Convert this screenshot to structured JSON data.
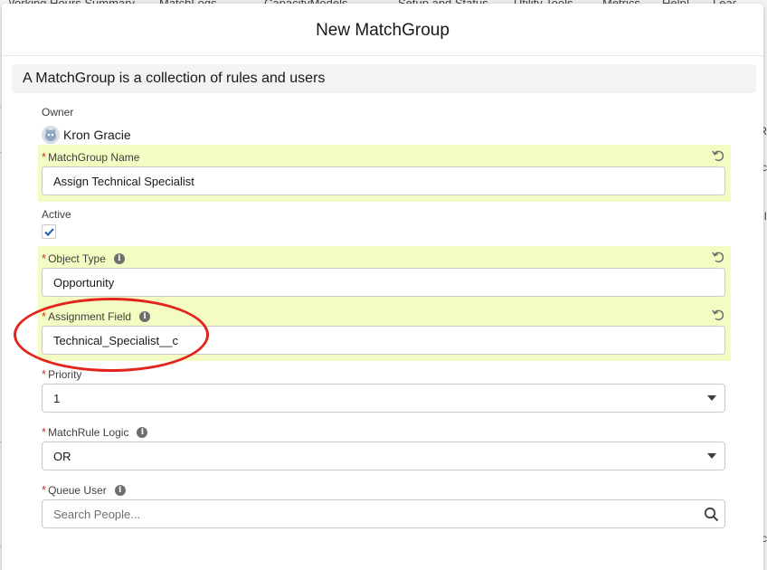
{
  "background": {
    "nav_items": [
      "Working Hours Summary",
      "MatchLogs",
      "CapacityModels",
      "Setup and Status",
      "Utility Tools",
      "Metrics",
      "Help!",
      "Leads"
    ],
    "right_cells": [
      "R",
      "c",
      "I",
      "c"
    ]
  },
  "modal": {
    "title": "New MatchGroup",
    "section_heading": "A MatchGroup is a collection of rules and users"
  },
  "fields": {
    "owner": {
      "label": "Owner",
      "value": "Kron Gracie"
    },
    "name": {
      "required_mark": "*",
      "label": "MatchGroup Name",
      "value": "Assign Technical Specialist"
    },
    "active": {
      "label": "Active",
      "checked": true
    },
    "object_type": {
      "required_mark": "*",
      "label": "Object Type",
      "value": "Opportunity"
    },
    "assignment_field": {
      "required_mark": "*",
      "label": "Assignment Field",
      "value": "Technical_Specialist__c"
    },
    "priority": {
      "required_mark": "*",
      "label": "Priority",
      "value": "1"
    },
    "logic": {
      "required_mark": "*",
      "label": "MatchRule Logic",
      "value": "OR"
    },
    "queue_user": {
      "required_mark": "*",
      "label": "Queue User",
      "placeholder": "Search People..."
    }
  },
  "icons": {
    "info": "info-icon",
    "undo": "undo-icon",
    "search": "search-icon",
    "caret": "chevron-down-icon",
    "check": "checkmark-icon"
  },
  "colors": {
    "highlight": "#f4fbc3",
    "required": "#c23934",
    "annotation": "#e3241b",
    "checkmark": "#1b5fa8"
  },
  "info_glyph": "i"
}
